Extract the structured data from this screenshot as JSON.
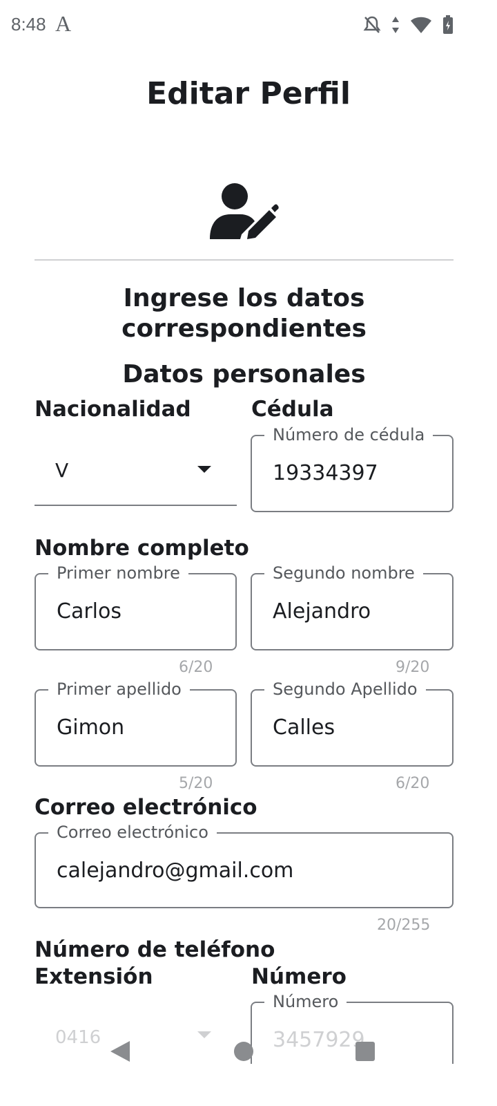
{
  "status_bar": {
    "time": "8:48",
    "app_glyph": "A"
  },
  "title": "Editar Perfil",
  "section_heading": "Ingrese los datos correspondientes",
  "section_subheading": "Datos personales",
  "nacionalidad": {
    "label": "Nacionalidad",
    "value": "V"
  },
  "cedula": {
    "label": "Cédula",
    "field_label": "Número de cédula",
    "value": "19334397"
  },
  "nombre_completo": {
    "label": "Nombre completo",
    "primer_nombre": {
      "field_label": "Primer nombre",
      "value": "Carlos",
      "counter": "6/20"
    },
    "segundo_nombre": {
      "field_label": "Segundo nombre",
      "value": "Alejandro",
      "counter": "9/20"
    },
    "primer_apellido": {
      "field_label": "Primer apellido",
      "value": "Gimon",
      "counter": "5/20"
    },
    "segundo_apellido": {
      "field_label": "Segundo Apellido",
      "value": "Calles",
      "counter": "6/20"
    }
  },
  "correo": {
    "label": "Correo electrónico",
    "field_label": "Correo electrónico",
    "value": "calejandro@gmail.com",
    "counter": "20/255"
  },
  "telefono": {
    "label": "Número de teléfono",
    "extension_label": "Extensión",
    "extension_value": "0416",
    "numero_label": "Número",
    "numero_field_label": "Número",
    "numero_value": "3457929"
  },
  "icons": [
    "mute-icon",
    "data-arrows-icon",
    "wifi-icon",
    "battery-icon",
    "user-edit-icon",
    "back-icon",
    "home-icon",
    "recents-icon"
  ]
}
